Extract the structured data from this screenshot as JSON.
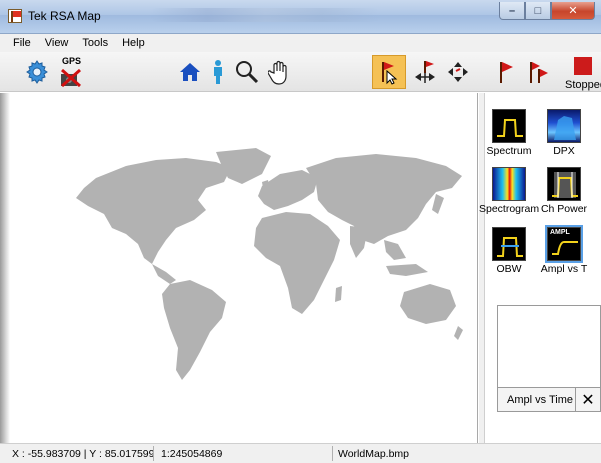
{
  "window": {
    "title": "Tek RSA Map",
    "controls": [
      "minimize",
      "maximize",
      "close"
    ]
  },
  "menu": {
    "items": [
      "File",
      "View",
      "Tools",
      "Help"
    ]
  },
  "toolbar": {
    "gps_label": "GPS",
    "buttons": [
      {
        "icon": "gear-icon"
      },
      {
        "icon": "gps-icon"
      },
      {
        "icon": "home-icon"
      },
      {
        "icon": "person-icon"
      },
      {
        "icon": "zoom-icon"
      },
      {
        "icon": "pan-hand-icon"
      },
      {
        "icon": "select-flag-icon",
        "active": true
      },
      {
        "icon": "flag-arrows-icon"
      },
      {
        "icon": "move-arrows-icon"
      },
      {
        "icon": "flag-icon"
      },
      {
        "icon": "multi-flag-icon"
      }
    ],
    "stopped_label": "Stopped",
    "stopped_color": "#cc1b1b",
    "active_color": "#f5c155"
  },
  "measurements": {
    "tiles": [
      {
        "label": "Spectrum"
      },
      {
        "label": "DPX"
      },
      {
        "label": "Spectrogram"
      },
      {
        "label": "Ch Power"
      },
      {
        "label": "OBW"
      },
      {
        "label": "Ampl vs T",
        "selected": true,
        "badge": "AMPL"
      }
    ]
  },
  "preview": {
    "label": "Ampl vs Time",
    "close_glyph": "✕"
  },
  "map": {
    "land_color": "#b2b2b2"
  },
  "status": {
    "coords": "X : -55.983709 | Y : 85.017599",
    "scale": "1:245054869",
    "file": "WorldMap.bmp"
  }
}
